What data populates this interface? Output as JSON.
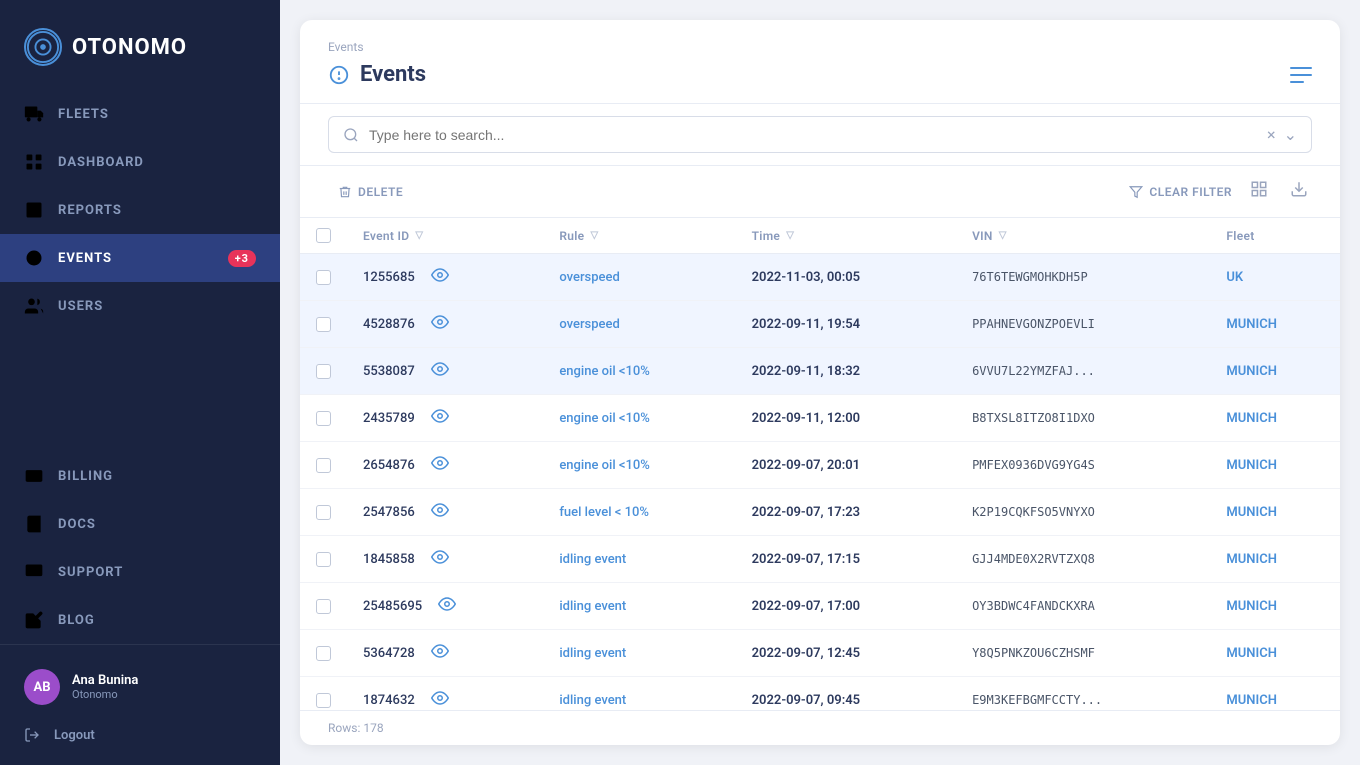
{
  "sidebar": {
    "logo_text": "OTONOMO",
    "nav_items": [
      {
        "id": "fleets",
        "label": "FLEETS",
        "icon": "fleets"
      },
      {
        "id": "dashboard",
        "label": "DASHBOARD",
        "icon": "dashboard"
      },
      {
        "id": "reports",
        "label": "REPORTS",
        "icon": "reports"
      },
      {
        "id": "events",
        "label": "EVENTS",
        "icon": "events",
        "badge": "+3",
        "active": true
      },
      {
        "id": "users",
        "label": "USERS",
        "icon": "users"
      }
    ],
    "bottom_items": [
      {
        "id": "billing",
        "label": "BILLING",
        "icon": "billing"
      },
      {
        "id": "docs",
        "label": "DOCS",
        "icon": "docs"
      },
      {
        "id": "support",
        "label": "SUPPORT",
        "icon": "support"
      },
      {
        "id": "blog",
        "label": "BLOG",
        "icon": "blog"
      }
    ],
    "user": {
      "initials": "AB",
      "name": "Ana Bunina",
      "company": "Otonomo"
    },
    "logout_label": "Logout"
  },
  "header": {
    "breadcrumb": "Events",
    "title": "Events",
    "title_icon": "💡"
  },
  "toolbar": {
    "search_placeholder": "Type here to search..."
  },
  "actions": {
    "delete_label": "DELETE",
    "clear_filter_label": "CLEAR FILTER"
  },
  "table": {
    "columns": [
      {
        "id": "event_id",
        "label": "Event ID"
      },
      {
        "id": "rule",
        "label": "Rule"
      },
      {
        "id": "time",
        "label": "Time"
      },
      {
        "id": "vin",
        "label": "VIN"
      },
      {
        "id": "fleet",
        "label": "Fleet"
      }
    ],
    "rows": [
      {
        "id": "1255685",
        "rule": "overspeed",
        "time": "2022-11-03, 00:05",
        "vin": "76T6TEWGMOHKDH5P",
        "fleet": "UK",
        "highlighted": true
      },
      {
        "id": "4528876",
        "rule": "overspeed",
        "time": "2022-09-11, 19:54",
        "vin": "PPAHNEVGONZPOEVLI",
        "fleet": "MUNICH",
        "highlighted": true
      },
      {
        "id": "5538087",
        "rule": "engine oil <10%",
        "time": "2022-09-11, 18:32",
        "vin": "6VVU7L22YMZFAJ...",
        "fleet": "MUNICH",
        "highlighted": true
      },
      {
        "id": "2435789",
        "rule": "engine oil <10%",
        "time": "2022-09-11, 12:00",
        "vin": "B8TXSL8ITZO8I1DXO",
        "fleet": "MUNICH",
        "highlighted": false
      },
      {
        "id": "2654876",
        "rule": "engine oil <10%",
        "time": "2022-09-07, 20:01",
        "vin": "PMFEX0936DVG9YG4S",
        "fleet": "MUNICH",
        "highlighted": false
      },
      {
        "id": "2547856",
        "rule": "fuel level < 10%",
        "time": "2022-09-07, 17:23",
        "vin": "K2P19CQKFSO5VNYXO",
        "fleet": "MUNICH",
        "highlighted": false
      },
      {
        "id": "1845858",
        "rule": "idling event",
        "time": "2022-09-07, 17:15",
        "vin": "GJJ4MDE0X2RVTZXQ8",
        "fleet": "MUNICH",
        "highlighted": false
      },
      {
        "id": "25485695",
        "rule": "idling event",
        "time": "2022-09-07, 17:00",
        "vin": "OY3BDWC4FANDCKXRA",
        "fleet": "MUNICH",
        "highlighted": false
      },
      {
        "id": "5364728",
        "rule": "idling event",
        "time": "2022-09-07, 12:45",
        "vin": "Y8Q5PNKZOU6CZHSMF",
        "fleet": "MUNICH",
        "highlighted": false
      },
      {
        "id": "1874632",
        "rule": "idling event",
        "time": "2022-09-07, 09:45",
        "vin": "E9M3KEFBGMFCCTY...",
        "fleet": "MUNICH",
        "highlighted": false
      }
    ],
    "rows_count": "Rows: 178"
  },
  "colors": {
    "sidebar_bg": "#1a2340",
    "active_nav": "#2d4080",
    "accent": "#4a90d9",
    "badge_bg": "#e8335a",
    "highlighted_row": "#f0f5ff"
  }
}
